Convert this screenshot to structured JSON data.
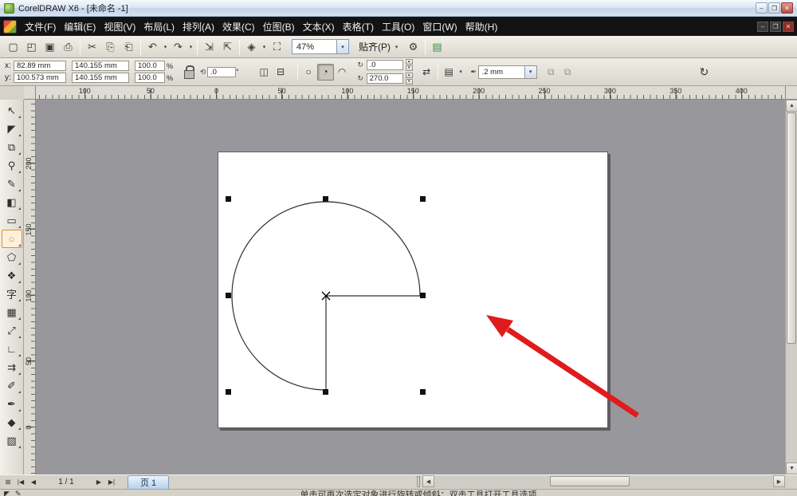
{
  "titlebar": {
    "title": "CorelDRAW X6 - [未命名 -1]",
    "minimize": "–",
    "maximize": "❐",
    "close": "✕"
  },
  "menubar": {
    "items": [
      "文件(F)",
      "编辑(E)",
      "视图(V)",
      "布局(L)",
      "排列(A)",
      "效果(C)",
      "位图(B)",
      "文本(X)",
      "表格(T)",
      "工具(O)",
      "窗口(W)",
      "帮助(H)"
    ],
    "doc_minimize": "–",
    "doc_restore": "❐",
    "doc_close": "✕"
  },
  "std_toolbar": {
    "items": [
      {
        "name": "new-document-button",
        "glyph": "▢"
      },
      {
        "name": "open-button",
        "glyph": "◰"
      },
      {
        "name": "save-button",
        "glyph": "▣"
      },
      {
        "name": "print-button",
        "glyph": "⎙"
      },
      {
        "sep": true
      },
      {
        "name": "cut-button",
        "glyph": "✂"
      },
      {
        "name": "copy-button",
        "glyph": "⎘"
      },
      {
        "name": "paste-button",
        "glyph": "⎗"
      },
      {
        "sep": true
      },
      {
        "name": "undo-button",
        "glyph": "↶",
        "dropdown": true
      },
      {
        "name": "redo-button",
        "glyph": "↷",
        "dropdown": true
      },
      {
        "sep": true
      },
      {
        "name": "import-button",
        "glyph": "⇲"
      },
      {
        "name": "export-button",
        "glyph": "⇱"
      },
      {
        "sep": true
      },
      {
        "name": "application-launcher-button",
        "glyph": "◈",
        "dropdown": true
      },
      {
        "name": "fullscreen-preview-button",
        "glyph": "⛶"
      }
    ],
    "zoom_value": "47%",
    "snap_label": "贴齐(P)",
    "right_items": [
      {
        "name": "options-button",
        "glyph": "⚙"
      },
      {
        "sep": true
      },
      {
        "name": "welcome-screen-button",
        "glyph": "▤",
        "color": "#3f8f3f"
      }
    ]
  },
  "property_bar": {
    "x_label": "x:",
    "x_value": "82.89 mm",
    "y_label": "y:",
    "y_value": "100.573 mm",
    "width_value": "140.155 mm",
    "height_value": "140.155 mm",
    "scale_h": "100.0",
    "scale_v": "100.0",
    "percent": "%",
    "rotate_icon": "⟲",
    "rotate_value": ".0",
    "degree_suffix": "°",
    "mirror_h_glyph": "◫",
    "mirror_v_glyph": "⊟",
    "ellipse_glyph": "○",
    "pie_glyph": "◔",
    "arc_glyph": "◠",
    "angle_icon": "↻",
    "start_angle": ".0",
    "end_angle": "270.0",
    "direction_glyph": "⇄",
    "wrap_glyph": "▤",
    "outline_icon": "✒",
    "outline_value": ".2 mm",
    "disabled1_glyph": "⧉",
    "disabled2_glyph": "⧉",
    "right_glyph": "↻"
  },
  "rulers": {
    "h_labels": [
      "100",
      "50",
      "0",
      "50",
      "100",
      "150",
      "200",
      "250",
      "300",
      "350",
      "400"
    ],
    "v_labels": [
      "200",
      "150",
      "100",
      "50",
      "0"
    ]
  },
  "toolbox": {
    "tools": [
      {
        "name": "pick-tool",
        "glyph": "↖"
      },
      {
        "name": "shape-tool",
        "glyph": "◤"
      },
      {
        "name": "crop-tool",
        "glyph": "⧉"
      },
      {
        "name": "zoom-tool",
        "glyph": "⚲"
      },
      {
        "name": "freehand-tool",
        "glyph": "✎"
      },
      {
        "name": "smart-fill-tool",
        "glyph": "◧"
      },
      {
        "name": "rectangle-tool",
        "glyph": "▭"
      },
      {
        "name": "ellipse-tool",
        "glyph": "○",
        "selected": true
      },
      {
        "name": "polygon-tool",
        "glyph": "⬠"
      },
      {
        "name": "basic-shapes-tool",
        "glyph": "❖"
      },
      {
        "name": "text-tool",
        "glyph": "字"
      },
      {
        "name": "table-tool",
        "glyph": "▦"
      },
      {
        "name": "dimension-tool",
        "glyph": "⤢"
      },
      {
        "name": "connector-tool",
        "glyph": "∟"
      },
      {
        "name": "blend-tool",
        "glyph": "⇉"
      },
      {
        "name": "eyedropper-tool",
        "glyph": "✐"
      },
      {
        "name": "outline-pen-tool",
        "glyph": "✒"
      },
      {
        "name": "fill-tool",
        "glyph": "◆"
      },
      {
        "name": "interactive-fill-tool",
        "glyph": "▨"
      }
    ]
  },
  "canvas_object": {
    "shape": "pie",
    "start_angle_deg": "0",
    "end_angle_deg": "270"
  },
  "pagebar": {
    "add_page": "⊞",
    "first": "|◀",
    "prev": "◀",
    "indicator": "1 / 1",
    "next": "▶",
    "last": "▶|",
    "page_tab": "页 1",
    "hscroll_left": "◀",
    "hscroll_right": "▶"
  },
  "vscroll": {
    "up": "▲",
    "down": "▼"
  },
  "statusbar": {
    "icon1": "◤",
    "icon2": "✎",
    "hint": "单击可再次选定对象进行旋转或倾斜；双击工具打开工具选项"
  },
  "ui": {
    "dropdown_arrow": "▾",
    "spin_up": "▴",
    "spin_down": "▾"
  },
  "colors": {
    "accent_red": "#e01b1b",
    "handle": "#111111",
    "canvas_bg": "#98979c"
  }
}
